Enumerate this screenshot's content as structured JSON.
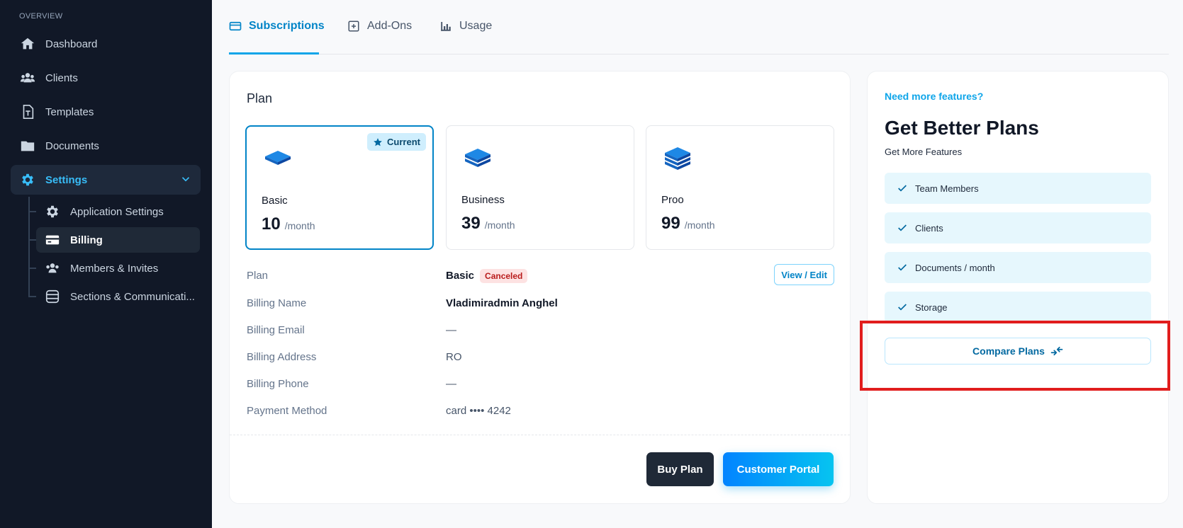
{
  "sidebar": {
    "section_label": "OVERVIEW",
    "items": [
      {
        "label": "Dashboard",
        "icon": "home-icon"
      },
      {
        "label": "Clients",
        "icon": "users-icon"
      },
      {
        "label": "Templates",
        "icon": "template-icon"
      },
      {
        "label": "Documents",
        "icon": "folder-icon"
      },
      {
        "label": "Settings",
        "icon": "gear-icon"
      }
    ],
    "settings_children": [
      {
        "label": "Application Settings",
        "icon": "gear-icon"
      },
      {
        "label": "Billing",
        "icon": "credit-card-icon"
      },
      {
        "label": "Members & Invites",
        "icon": "users-icon"
      },
      {
        "label": "Sections & Communicati...",
        "icon": "database-icon"
      }
    ]
  },
  "tabs": [
    {
      "label": "Subscriptions",
      "icon": "credit-card-icon",
      "active": true
    },
    {
      "label": "Add-Ons",
      "icon": "plus-square-icon",
      "active": false
    },
    {
      "label": "Usage",
      "icon": "bar-chart-icon",
      "active": false
    }
  ],
  "plan": {
    "title": "Plan",
    "current_badge": "Current",
    "options": [
      {
        "name": "Basic",
        "price": "10",
        "period": "/month"
      },
      {
        "name": "Business",
        "price": "39",
        "period": "/month"
      },
      {
        "name": "Proo",
        "price": "99",
        "period": "/month"
      }
    ],
    "details": {
      "plan_label": "Plan",
      "plan_value": "Basic",
      "plan_status": "Canceled",
      "view_edit": "View / Edit",
      "billing_name_label": "Billing Name",
      "billing_name_value": "Vladimiradmin Anghel",
      "billing_email_label": "Billing Email",
      "billing_email_value": "—",
      "billing_address_label": "Billing Address",
      "billing_address_value": "RO",
      "billing_phone_label": "Billing Phone",
      "billing_phone_value": "—",
      "payment_method_label": "Payment Method",
      "payment_method_value": "card •••• 4242"
    },
    "buy_button": "Buy Plan",
    "portal_button": "Customer Portal"
  },
  "upsell": {
    "link": "Need more features?",
    "title": "Get Better Plans",
    "subtitle": "Get More Features",
    "features": [
      "Team Members",
      "Clients",
      "Documents / month",
      "Storage"
    ],
    "compare_button": "Compare Plans"
  },
  "colors": {
    "accent": "#0ea5e9",
    "sidebar_bg": "#111827",
    "danger": "#b91c1c",
    "highlight": "#e11d1d"
  }
}
